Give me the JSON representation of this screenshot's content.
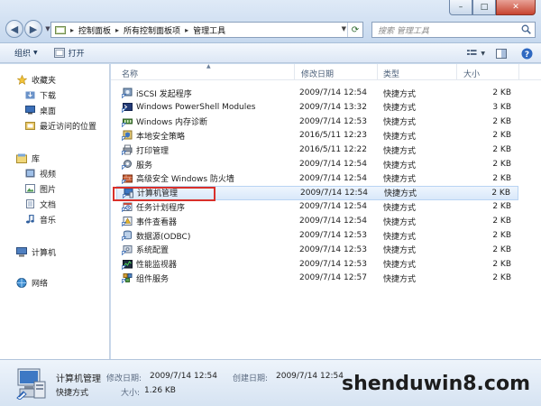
{
  "window": {
    "minimize": "–",
    "maximize": "□",
    "close": "✕"
  },
  "address": {
    "crumbs": [
      "控制面板",
      "所有控制面板项",
      "管理工具"
    ]
  },
  "search": {
    "placeholder": "搜索 管理工具"
  },
  "toolbar": {
    "organize": "组织",
    "open": "打开"
  },
  "navpane": {
    "favorites": "收藏夹",
    "downloads": "下载",
    "desktop": "桌面",
    "recent": "最近访问的位置",
    "libraries": "库",
    "videos": "视频",
    "pictures": "图片",
    "documents": "文档",
    "music": "音乐",
    "computer": "计算机",
    "network": "网络"
  },
  "columns": {
    "name": "名称",
    "date": "修改日期",
    "type": "类型",
    "size": "大小"
  },
  "files": [
    {
      "name": "iSCSI 发起程序",
      "date": "2009/7/14 12:54",
      "type": "快捷方式",
      "size": "2 KB",
      "icon": "iscsi-icon"
    },
    {
      "name": "Windows PowerShell Modules",
      "date": "2009/7/14 13:32",
      "type": "快捷方式",
      "size": "3 KB",
      "icon": "powershell-icon"
    },
    {
      "name": "Windows 内存诊断",
      "date": "2009/7/14 12:53",
      "type": "快捷方式",
      "size": "2 KB",
      "icon": "memory-diagnostic-icon"
    },
    {
      "name": "本地安全策略",
      "date": "2016/5/11 12:23",
      "type": "快捷方式",
      "size": "2 KB",
      "icon": "security-policy-icon"
    },
    {
      "name": "打印管理",
      "date": "2016/5/11 12:22",
      "type": "快捷方式",
      "size": "2 KB",
      "icon": "print-management-icon"
    },
    {
      "name": "服务",
      "date": "2009/7/14 12:54",
      "type": "快捷方式",
      "size": "2 KB",
      "icon": "services-icon"
    },
    {
      "name": "高级安全 Windows 防火墙",
      "date": "2009/7/14 12:54",
      "type": "快捷方式",
      "size": "2 KB",
      "icon": "firewall-icon"
    },
    {
      "name": "计算机管理",
      "date": "2009/7/14 12:54",
      "type": "快捷方式",
      "size": "2 KB",
      "icon": "computer-management-icon"
    },
    {
      "name": "任务计划程序",
      "date": "2009/7/14 12:54",
      "type": "快捷方式",
      "size": "2 KB",
      "icon": "task-scheduler-icon"
    },
    {
      "name": "事件查看器",
      "date": "2009/7/14 12:54",
      "type": "快捷方式",
      "size": "2 KB",
      "icon": "event-viewer-icon"
    },
    {
      "name": "数据源(ODBC)",
      "date": "2009/7/14 12:53",
      "type": "快捷方式",
      "size": "2 KB",
      "icon": "odbc-icon"
    },
    {
      "name": "系统配置",
      "date": "2009/7/14 12:53",
      "type": "快捷方式",
      "size": "2 KB",
      "icon": "system-config-icon"
    },
    {
      "name": "性能监视器",
      "date": "2009/7/14 12:53",
      "type": "快捷方式",
      "size": "2 KB",
      "icon": "performance-monitor-icon"
    },
    {
      "name": "组件服务",
      "date": "2009/7/14 12:57",
      "type": "快捷方式",
      "size": "2 KB",
      "icon": "component-services-icon"
    }
  ],
  "selected_index": 7,
  "details": {
    "name": "计算机管理",
    "modified_label": "修改日期:",
    "modified_value": "2009/7/14 12:54",
    "created_label": "创建日期:",
    "created_value": "2009/7/14 12:54",
    "type": "快捷方式",
    "size_label": "大小:",
    "size_value": "1.26 KB"
  },
  "watermark": "shenduwin8.com",
  "colors": {
    "highlight_box": "#d9302a",
    "selection": "#d9e8fa"
  }
}
